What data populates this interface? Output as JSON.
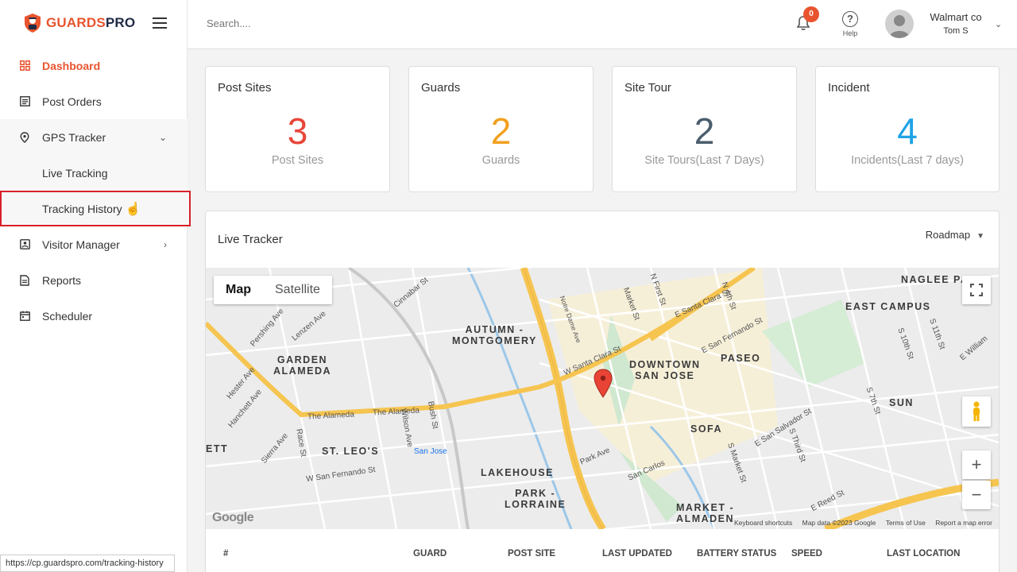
{
  "brand": {
    "name_part1": "GUARDS",
    "name_part2": "PRO"
  },
  "sidebar": {
    "items": [
      {
        "label": "Dashboard",
        "icon": "grid-icon"
      },
      {
        "label": "Post Orders",
        "icon": "list-icon"
      },
      {
        "label": "GPS Tracker",
        "icon": "location-pin-icon"
      },
      {
        "label": "Visitor Manager",
        "icon": "id-card-icon"
      },
      {
        "label": "Reports",
        "icon": "document-icon"
      },
      {
        "label": "Scheduler",
        "icon": "calendar-icon"
      }
    ],
    "gps_subitems": [
      {
        "label": "Live Tracking"
      },
      {
        "label": "Tracking History"
      }
    ]
  },
  "status_url": "https://cp.guardspro.com/tracking-history",
  "topbar": {
    "search_placeholder": "Search....",
    "notification_count": "0",
    "help_label": "Help",
    "user_company": "Walmart co",
    "user_name": "Tom S"
  },
  "cards": [
    {
      "title": "Post Sites",
      "value": "3",
      "sub": "Post Sites",
      "color": "#e8463a"
    },
    {
      "title": "Guards",
      "value": "2",
      "sub": "Guards",
      "color": "#f2a01f"
    },
    {
      "title": "Site Tour",
      "value": "2",
      "sub": "Site Tours(Last 7 Days)",
      "color": "#4b5e6e"
    },
    {
      "title": "Incident",
      "value": "4",
      "sub": "Incidents(Last 7 days)",
      "color": "#1fa3e6"
    }
  ],
  "tracker": {
    "title": "Live Tracker",
    "map_type": "Roadmap",
    "tabs": {
      "map": "Map",
      "satellite": "Satellite"
    },
    "map_labels": {
      "autumn": "AUTUMN -\nMONTGOMERY",
      "garden": "GARDEN\nALAMEDA",
      "downtown": "DOWNTOWN\nSAN JOSE",
      "paseo": "PASEO",
      "east_campus": "EAST CAMPUS",
      "naglee": "NAGLEE PA",
      "st_leos": "ST. LEO'S",
      "lakehouse": "LAKEHOUSE",
      "park_lorraine": "PARK -\nLORRAINE",
      "sofa": "SOFA",
      "sun": "SUN",
      "market_almaden": "MARKET -\nALMADEN",
      "ett": "ETT"
    },
    "streets": {
      "alameda1": "The Alameda",
      "alameda2": "The Alameda",
      "santa_clara": "W Santa Clara St",
      "e_santa_clara": "E Santa Clara St",
      "san_jose_station": "San Jose",
      "park_ave": "Park Ave",
      "san_carlos": "San Carlos",
      "e_san_salvador": "E San Salvador St",
      "e_san_fernando": "E San Fernando St",
      "w_san_fernando": "W San Fernando St",
      "market": "Market St",
      "s_market": "S Market St",
      "first": "N First St",
      "fourth": "N 4th St",
      "s_third": "S Third St",
      "s_seventh": "S 7th St",
      "s_tenth": "S 10th St",
      "s_eleventh": "S 11th St",
      "e_reed": "E Reed St",
      "race": "Race St",
      "n_san_pedro": "Notre Dame Ave",
      "cinnabar": "Cinnabar St",
      "lenzen": "Lenzen Ave",
      "pershing": "Pershing Ave",
      "hanchett": "Hanchett Ave",
      "sierra": "Sierra Ave",
      "hester": "Hester Ave",
      "wilson": "Wilson Ave",
      "bush": "Bush St",
      "e_william": "E William"
    },
    "footer": {
      "shortcuts": "Keyboard shortcuts",
      "mapdata": "Map data ©2023 Google",
      "terms": "Terms of Use",
      "report": "Report a map error"
    },
    "google": "Google",
    "table_headers": [
      "#",
      "GUARD",
      "POST SITE",
      "LAST UPDATED",
      "BATTERY STATUS",
      "SPEED",
      "LAST LOCATION"
    ]
  }
}
